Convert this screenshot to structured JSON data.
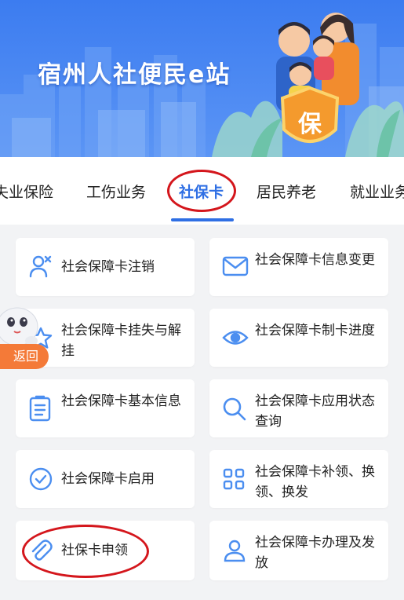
{
  "banner": {
    "title": "宿州人社便民e站",
    "shield_char": "保"
  },
  "tabs": [
    {
      "label": "失业保险",
      "active": false
    },
    {
      "label": "工伤业务",
      "active": false
    },
    {
      "label": "社保卡",
      "active": true
    },
    {
      "label": "居民养老",
      "active": false
    },
    {
      "label": "就业业务",
      "active": false
    }
  ],
  "services": [
    {
      "label": "社会保障卡注销",
      "icon": "user-cancel-icon"
    },
    {
      "label": "社会保障卡信息变更",
      "icon": "envelope-icon"
    },
    {
      "label": "社会保障卡挂失与解挂",
      "icon": "star-icon"
    },
    {
      "label": "社会保障卡制卡进度",
      "icon": "eye-icon"
    },
    {
      "label": "社会保障卡基本信息",
      "icon": "document-list-icon"
    },
    {
      "label": "社会保障卡应用状态查询",
      "icon": "search-icon"
    },
    {
      "label": "社会保障卡启用",
      "icon": "check-circle-icon"
    },
    {
      "label": "社会保障卡补领、换领、换发",
      "icon": "grid-icon"
    },
    {
      "label": "社保卡申领",
      "icon": "paperclip-icon"
    },
    {
      "label": "社会保障卡办理及发放",
      "icon": "person-icon"
    }
  ],
  "floating": {
    "back_label": "返回"
  },
  "colors": {
    "accent": "#2f6fe4",
    "icon_blue": "#4b8ef0",
    "annotation_red": "#d4161c",
    "back_orange": "#f47a38"
  }
}
